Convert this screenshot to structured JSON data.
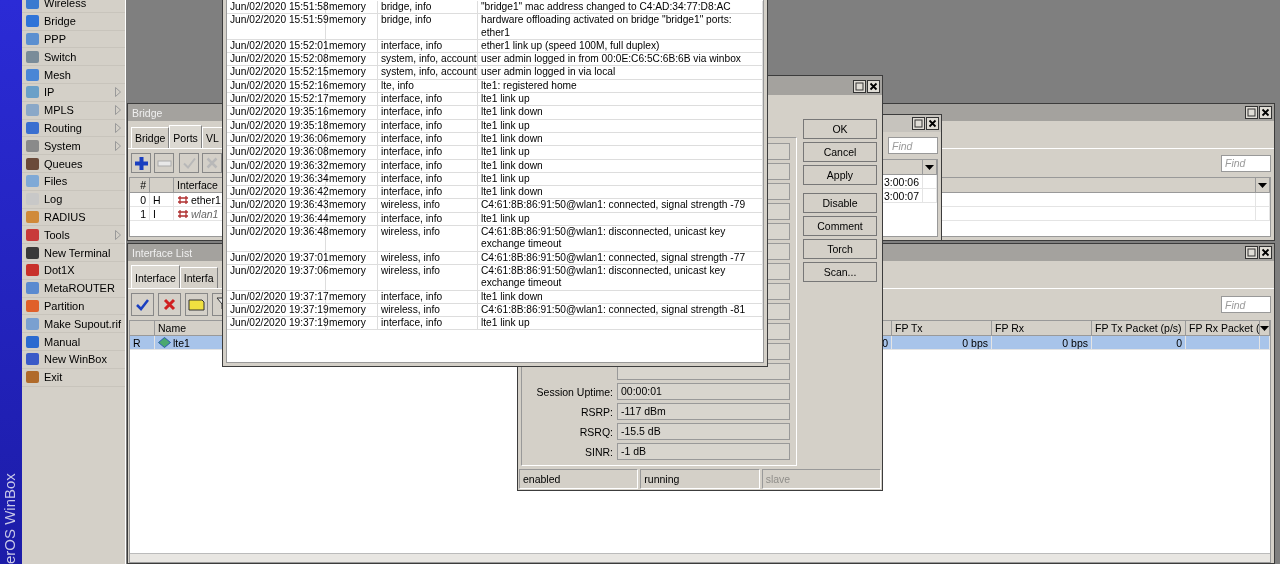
{
  "sidebar": {
    "brand": "erOS WinBox",
    "items": [
      {
        "label": "Wireless",
        "submenu": false
      },
      {
        "label": "Bridge",
        "submenu": false
      },
      {
        "label": "PPP",
        "submenu": false
      },
      {
        "label": "Switch",
        "submenu": false
      },
      {
        "label": "Mesh",
        "submenu": false
      },
      {
        "label": "IP",
        "submenu": true
      },
      {
        "label": "MPLS",
        "submenu": true
      },
      {
        "label": "Routing",
        "submenu": true
      },
      {
        "label": "System",
        "submenu": true
      },
      {
        "label": "Queues",
        "submenu": false
      },
      {
        "label": "Files",
        "submenu": false
      },
      {
        "label": "Log",
        "submenu": false
      },
      {
        "label": "RADIUS",
        "submenu": false
      },
      {
        "label": "Tools",
        "submenu": true
      },
      {
        "label": "New Terminal",
        "submenu": false
      },
      {
        "label": "Dot1X",
        "submenu": false
      },
      {
        "label": "MetaROUTER",
        "submenu": false
      },
      {
        "label": "Partition",
        "submenu": false
      },
      {
        "label": "Make Supout.rif",
        "submenu": false
      },
      {
        "label": "Manual",
        "submenu": false
      },
      {
        "label": "New WinBox",
        "submenu": false
      },
      {
        "label": "Exit",
        "submenu": false
      }
    ]
  },
  "bridge_window": {
    "title": "Bridge",
    "tabs": [
      {
        "label": "Bridge",
        "selected": false
      },
      {
        "label": "Ports",
        "selected": true
      },
      {
        "label": "VL",
        "selected": false
      }
    ],
    "find": {
      "placeholder": "Find"
    },
    "columns": [
      "#",
      "Interface"
    ],
    "rows": [
      {
        "number": "0",
        "flag": "H",
        "interface": "ether1",
        "inactive": false
      },
      {
        "number": "1",
        "flag": "I",
        "interface": "wlan1",
        "inactive": true
      }
    ]
  },
  "small_window": {
    "find": {
      "placeholder": "Find"
    },
    "rows": [
      "3:00:06",
      "3:00:07"
    ]
  },
  "interface_list": {
    "title": "Interface List",
    "tabs": [
      {
        "label": "Interface",
        "selected": true
      },
      {
        "label": "Interfa",
        "selected": false
      }
    ],
    "find": {
      "placeholder": "Find"
    },
    "columns": [
      "Name",
      "FP Tx",
      "FP Rx",
      "FP Tx Packet (p/s)",
      "FP Rx Packet ("
    ],
    "rows": [
      {
        "flag": "R",
        "name": "lte1",
        "column_3": "0",
        "fp_tx": "0 bps",
        "fp_rx": "0 bps",
        "fp_tx_packet": "0",
        "selected": true
      }
    ]
  },
  "interface_dialog": {
    "fields": [
      {
        "label": "Session Uptime:",
        "value": "00:00:01"
      },
      {
        "label": "RSRP:",
        "value": "-117 dBm"
      },
      {
        "label": "RSRQ:",
        "value": "-15.5 dB"
      },
      {
        "label": "SINR:",
        "value": "-1 dB"
      }
    ],
    "buttons": [
      "OK",
      "Cancel",
      "Apply",
      "Disable",
      "Comment",
      "Torch",
      "Scan..."
    ],
    "status": [
      {
        "text": "enabled",
        "disabled": false
      },
      {
        "text": "running",
        "disabled": false
      },
      {
        "text": "slave",
        "disabled": true
      }
    ]
  },
  "log_window": {
    "rows": [
      {
        "time": "Jun/02/2020 15:51:58",
        "buffer": "memory",
        "topics": "bridge, info",
        "message": "\"bridge1\" mac address changed to C4:AD:34:77:D8:AC"
      },
      {
        "time": "Jun/02/2020 15:51:59",
        "buffer": "memory",
        "topics": "bridge, info",
        "message": "hardware offloading activated on bridge \"bridge1\" ports: ether1"
      },
      {
        "time": "Jun/02/2020 15:52:01",
        "buffer": "memory",
        "topics": "interface, info",
        "message": "ether1 link up (speed 100M, full duplex)"
      },
      {
        "time": "Jun/02/2020 15:52:08",
        "buffer": "memory",
        "topics": "system, info, account",
        "message": "user admin logged in from 00:0E:C6:5C:6B:6B via winbox"
      },
      {
        "time": "Jun/02/2020 15:52:15",
        "buffer": "memory",
        "topics": "system, info, account",
        "message": "user admin logged in via local"
      },
      {
        "time": "Jun/02/2020 15:52:16",
        "buffer": "memory",
        "topics": "lte, info",
        "message": "lte1: registered home"
      },
      {
        "time": "Jun/02/2020 15:52:17",
        "buffer": "memory",
        "topics": "interface, info",
        "message": "lte1 link up"
      },
      {
        "time": "Jun/02/2020 19:35:16",
        "buffer": "memory",
        "topics": "interface, info",
        "message": "lte1 link down"
      },
      {
        "time": "Jun/02/2020 19:35:18",
        "buffer": "memory",
        "topics": "interface, info",
        "message": "lte1 link up"
      },
      {
        "time": "Jun/02/2020 19:36:06",
        "buffer": "memory",
        "topics": "interface, info",
        "message": "lte1 link down"
      },
      {
        "time": "Jun/02/2020 19:36:08",
        "buffer": "memory",
        "topics": "interface, info",
        "message": "lte1 link up"
      },
      {
        "time": "Jun/02/2020 19:36:32",
        "buffer": "memory",
        "topics": "interface, info",
        "message": "lte1 link down"
      },
      {
        "time": "Jun/02/2020 19:36:34",
        "buffer": "memory",
        "topics": "interface, info",
        "message": "lte1 link up"
      },
      {
        "time": "Jun/02/2020 19:36:42",
        "buffer": "memory",
        "topics": "interface, info",
        "message": "lte1 link down"
      },
      {
        "time": "Jun/02/2020 19:36:43",
        "buffer": "memory",
        "topics": "wireless, info",
        "message": "C4:61:8B:86:91:50@wlan1: connected, signal strength -79"
      },
      {
        "time": "Jun/02/2020 19:36:44",
        "buffer": "memory",
        "topics": "interface, info",
        "message": "lte1 link up"
      },
      {
        "time": "Jun/02/2020 19:36:48",
        "buffer": "memory",
        "topics": "wireless, info",
        "message": "C4:61:8B:86:91:50@wlan1: disconnected, unicast key exchange timeout"
      },
      {
        "time": "Jun/02/2020 19:37:01",
        "buffer": "memory",
        "topics": "wireless, info",
        "message": "C4:61:8B:86:91:50@wlan1: connected, signal strength -77"
      },
      {
        "time": "Jun/02/2020 19:37:06",
        "buffer": "memory",
        "topics": "wireless, info",
        "message": "C4:61:8B:86:91:50@wlan1: disconnected, unicast key exchange timeout"
      },
      {
        "time": "Jun/02/2020 19:37:17",
        "buffer": "memory",
        "topics": "interface, info",
        "message": "lte1 link down"
      },
      {
        "time": "Jun/02/2020 19:37:19",
        "buffer": "memory",
        "topics": "wireless, info",
        "message": "C4:61:8B:86:91:50@wlan1: connected, signal strength -81"
      },
      {
        "time": "Jun/02/2020 19:37:19",
        "buffer": "memory",
        "topics": "interface, info",
        "message": "lte1 link up"
      }
    ]
  }
}
